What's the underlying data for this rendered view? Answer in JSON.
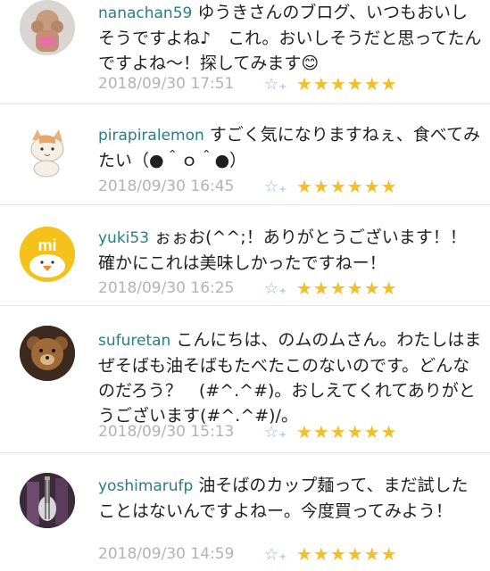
{
  "comments": [
    {
      "user": "nanachan59",
      "text": "ゆうきさんのブログ、いつもおいしそうですよね♪　これ。おいしそうだと思ってたんですよね〜！探してみます😊",
      "date": "2018/09/30 17:51",
      "fav_icon": "☆₊",
      "stars": "★★★★★★",
      "avatar_icon": "dog-avatar"
    },
    {
      "user": "pirapiralemon",
      "text": "すごく気になりますねぇ、食べてみたい（●＾ｏ＾●）",
      "date": "2018/09/30 16:45",
      "fav_icon": "☆₊",
      "stars": "★★★★★★",
      "avatar_icon": "cat-avatar"
    },
    {
      "user": "yuki53",
      "text": "ぉぉお(^^;！ありがとうございます！！確かにこれは美味しかったですねー！",
      "date": "2018/09/30 16:25",
      "fav_icon": "☆₊",
      "stars": "★★★★★★",
      "avatar_icon": "mi-chick-avatar",
      "avatar_text": "mi"
    },
    {
      "user": "sufuretan",
      "text": "こんにちは、のムのムさん。わたしはまぜそばも油そばもたべたこのないのです。どんなのだろう？　(#^.^#)。おしえてくれてありがとうございます(#^.^#)/。",
      "date": "2018/09/30 15:13",
      "fav_icon": "☆₊",
      "stars": "★★★★★★",
      "avatar_icon": "teddy-bear-avatar"
    },
    {
      "user": "yoshimarufp",
      "text": "油そばのカップ麺って、まだ試したことはないんですよねー。今度買ってみよう！",
      "date": "2018/09/30 14:59",
      "fav_icon": "☆₊",
      "stars": "★★★★★★",
      "avatar_icon": "guitar-avatar"
    }
  ],
  "colors": {
    "username": "#2b7c86",
    "date": "#b3b3b3",
    "star": "#f2be2a",
    "fav_icon": "#8fb8ee"
  }
}
